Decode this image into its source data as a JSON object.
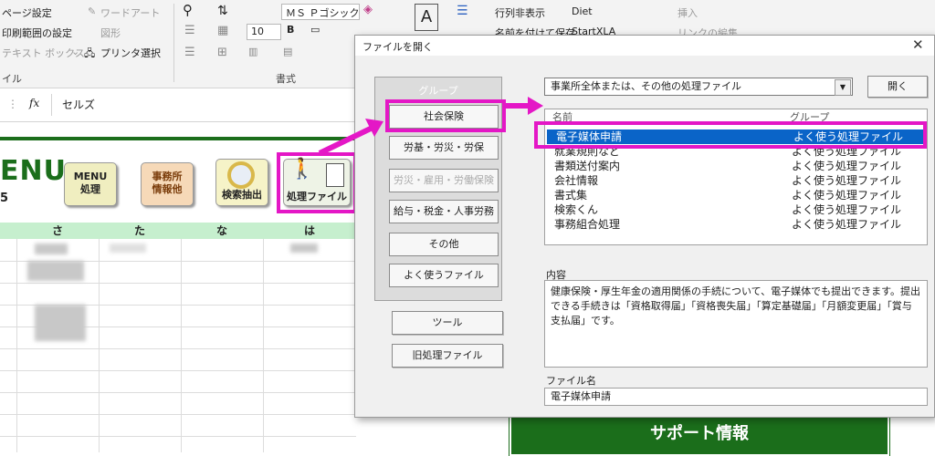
{
  "ribbon": {
    "page_setup": "ページ設定",
    "print_area": "印刷範囲の設定",
    "text_box": "テキスト ボックス",
    "printer_select": "プリンタ選択",
    "wordart": "ワードアート",
    "shapes": "図形",
    "font_name": "ＭＳ Ｐゴシック",
    "font_size": "10",
    "hide_rows": "行列非表示",
    "diet": "Diet",
    "save_as": "名前を付けて保存",
    "startxla": "StartXLA",
    "insert": "挿入",
    "edit_link": "リンクの編集",
    "group_label_left": "イル",
    "group_label_format": "書式"
  },
  "formula_bar": {
    "fx": "fx",
    "value": "セルズ"
  },
  "sheet": {
    "menu_title": "ENU",
    "row_label": "5",
    "btn_menu": "MENU\n処理",
    "btn_office": "事務所\n情報他",
    "btn_search": "検索抽出",
    "btn_process": "処理ファイル",
    "columns": [
      "",
      "さ",
      "た",
      "な",
      "は"
    ],
    "support_banner": "サポート情報"
  },
  "dialog": {
    "title": "ファイルを開く",
    "group_heading": "グループ",
    "groups": [
      "社会保険",
      "労基・労災・労保",
      "労災・雇用・労働保険",
      "給与・税金・人事労務",
      "その他",
      "よく使うファイル"
    ],
    "tools": "ツール",
    "old_files": "旧処理ファイル",
    "dropdown_value": "事業所全体または、その他の処理ファイル",
    "open_button": "開く",
    "list_headers": [
      "名前",
      "グループ"
    ],
    "files": [
      {
        "name": "電子媒体申請",
        "group": "よく使う処理ファイル",
        "selected": true
      },
      {
        "name": "就業規則など",
        "group": "よく使う処理ファイル"
      },
      {
        "name": "書類送付案内",
        "group": "よく使う処理ファイル"
      },
      {
        "name": "会社情報",
        "group": "よく使う処理ファイル"
      },
      {
        "name": "書式集",
        "group": "よく使う処理ファイル"
      },
      {
        "name": "検索くん",
        "group": "よく使う処理ファイル"
      },
      {
        "name": "事務組合処理",
        "group": "よく使う処理ファイル"
      }
    ],
    "content_label": "内容",
    "content_text": "健康保険・厚生年金の適用関係の手続について、電子媒体でも提出できます。提出できる手続きは「資格取得届」「資格喪失届」「算定基礎届」「月額変更届」「賞与支払届」です。",
    "filename_label": "ファイル名",
    "filename_value": "電子媒体申請"
  },
  "colors": {
    "highlight": "#e417c6",
    "selection": "#0a64c8",
    "green": "#1b6e1b",
    "header_green": "#c6efce"
  }
}
